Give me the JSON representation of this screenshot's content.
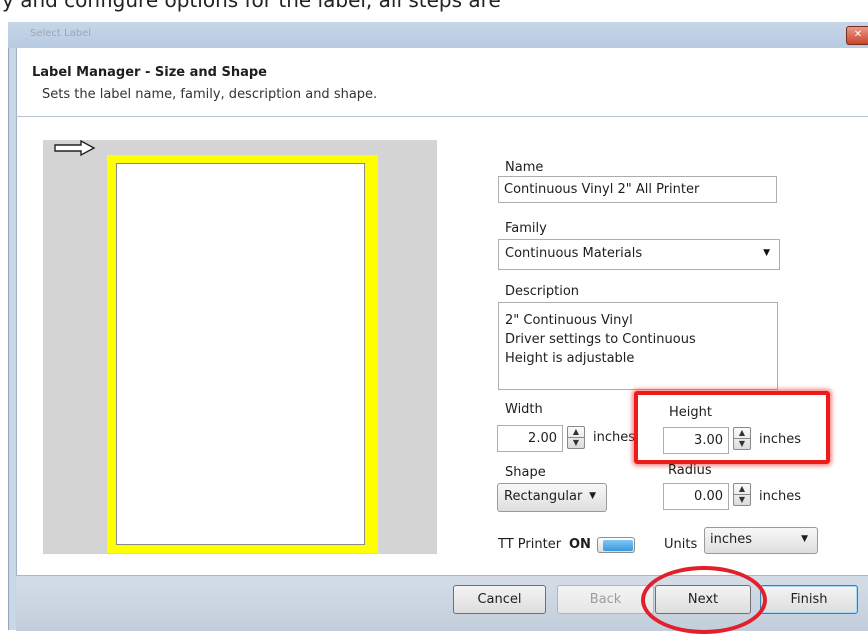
{
  "window": {
    "title": "Select Label",
    "close_glyph": "✕"
  },
  "header": {
    "title": "Label Manager - Size and Shape",
    "subtitle": "Sets the label name, family, description and shape."
  },
  "preview": {
    "arrow_icon": "feed-direction-arrow-icon",
    "label_color": "#ffff00",
    "background_color": "#d4d4d4"
  },
  "form": {
    "name": {
      "label": "Name",
      "value": "Continuous Vinyl 2\" All Printer"
    },
    "family": {
      "label": "Family",
      "value": "Continuous Materials",
      "arrow": "▼"
    },
    "description": {
      "label": "Description",
      "lines": [
        "2\" Continuous Vinyl",
        "Driver settings to Continuous",
        "Height is adjustable"
      ]
    },
    "width": {
      "label": "Width",
      "value": "2.00",
      "unit": "inches"
    },
    "height": {
      "label": "Height",
      "value": "3.00",
      "unit": "inches"
    },
    "shape": {
      "label": "Shape",
      "value": "Rectangular",
      "arrow": "▼"
    },
    "radius": {
      "label": "Radius",
      "value": "0.00",
      "unit": "inches"
    },
    "tt_printer": {
      "label": "TT Printer",
      "state": "ON"
    },
    "units": {
      "label": "Units",
      "value": "inches",
      "arrow": "▼"
    }
  },
  "spin": {
    "up": "▲",
    "down": "▼"
  },
  "footer": {
    "cancel": "Cancel",
    "back": "Back",
    "next": "Next",
    "finish": "Finish"
  },
  "annotations": {
    "highlight_color": "#ee1b1b"
  }
}
